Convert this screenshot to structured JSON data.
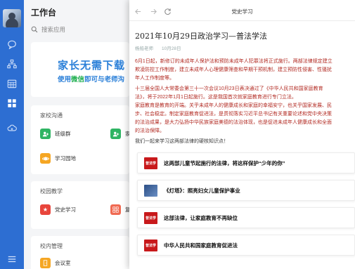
{
  "workbench": {
    "title": "工作台",
    "search_placeholder": "搜索应用",
    "banner_line1": "家长无需下载",
    "banner_line2a": "使用",
    "banner_line2b": "微信",
    "banner_line2c": "即可与老师沟"
  },
  "sections": {
    "home_school": {
      "header": "家校沟通",
      "apps": [
        "班级群",
        "家",
        "学习园地"
      ]
    },
    "campus": {
      "header": "校园教学",
      "apps": [
        "党史学习",
        "复"
      ]
    },
    "school_mgmt": {
      "header": "校内管理",
      "apps": [
        "会议室"
      ]
    }
  },
  "article": {
    "window_title": "党史学习",
    "title": "2021年10月29日政治学习—普法学法",
    "author": "杨船老师",
    "date": "10月28日",
    "para1": [
      "6月1日起，新修订的未成年人保护法和预防未成年人犯罪法将正式施行。两部法律规定建立",
      "欺凌防控工作制度，建立未成年人心理健康筛查和早期干预机制，建立预防性侵害、性骚扰",
      "年人工作制度等。"
    ],
    "para2": [
      "十三届全国人大常委会第三十一次会议10月23日表决通过了《中华人民共和国家庭教育",
      "法》，将于2022年1月1日起施行。这是我国首次就家庭教育进行专门立法。",
      "家庭教育是教育的开端。关乎未成年人的健康成长和家庭的幸福安宁，也关乎国家发展、民",
      "步、社会稳定。制定家庭教育促进法，是贯彻落实习近平总书记有关重要论述和党中央决策",
      "的法治成果，是大力弘扬中华民族家庭美德的法治体现，也是促进未成年人健康成长和全面",
      "的法治保障。"
    ],
    "para3": "我们一起来学习这两部法律的硬核知识点！",
    "links": [
      {
        "title": "这两部儿童节起施行的法律，将这样保护“少年的你”",
        "thumb": "普法学"
      },
      {
        "title": "《灯塔》：照亮妇女儿童保护事业",
        "thumb": ""
      },
      {
        "title": "这部法律，让家庭教育不再缺位",
        "thumb": "普法学"
      },
      {
        "title": "中华人民共和国家庭教育促进法",
        "thumb": "普法学"
      }
    ]
  },
  "colors": {
    "rail": "#2d6ed2",
    "accent_text": "#b22a22",
    "banner_blue": "#2a7fd8",
    "wechat_green": "#1fae4f"
  }
}
